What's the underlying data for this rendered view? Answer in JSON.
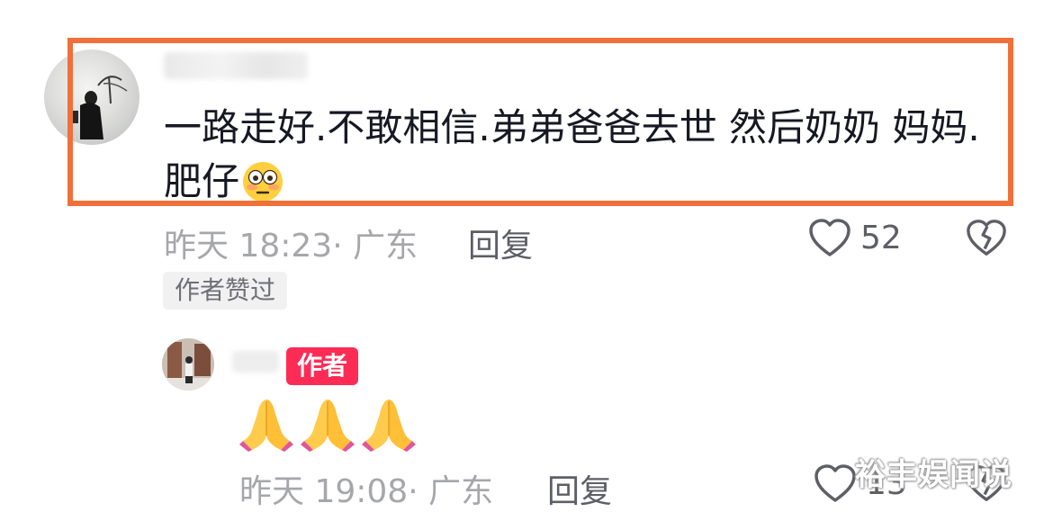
{
  "comment": {
    "text": "一路走好.不敢相信.弟弟爸爸去世 然后奶奶 妈妈.肥仔",
    "emoji": "flushed-face-emoji",
    "time": "昨天 18:23",
    "location": "· 广东",
    "reply_label": "回复",
    "like_count": "52",
    "author_liked_label": "作者赞过"
  },
  "reply": {
    "author_badge": "作者",
    "emoji_text": "🙏🙏🙏",
    "time": "昨天 19:08",
    "location": "· 广东",
    "reply_label": "回复",
    "like_count": "13"
  },
  "watermark": "裕丰娱闻说",
  "colors": {
    "highlight_border": "#f0703a",
    "author_badge_bg": "#fe2c55",
    "meta_gray": "#a6a7ab",
    "text_dark": "#161823"
  }
}
